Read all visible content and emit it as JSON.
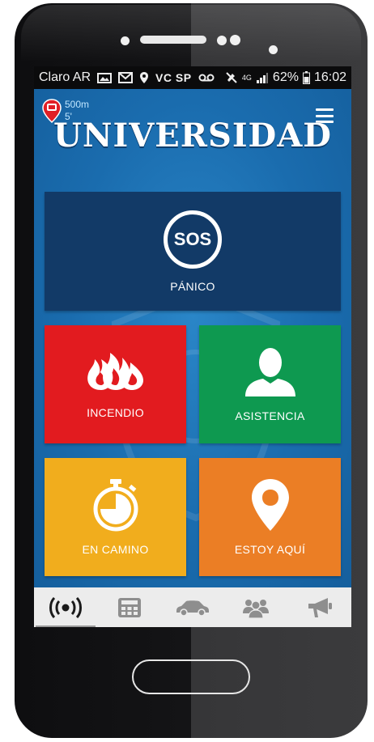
{
  "statusbar": {
    "carrier": "Claro AR",
    "network_tags": "VC SP",
    "signal_label": "4G",
    "battery": "62%",
    "time": "16:02"
  },
  "header": {
    "radius_distance": "500m",
    "radius_time": "5'",
    "title": "UNIVERSIDAD"
  },
  "tiles": {
    "panic": {
      "icon_text": "SOS",
      "label": "PÁNICO"
    },
    "fire": {
      "label": "INCENDIO"
    },
    "assistance": {
      "label": "ASISTENCIA"
    },
    "on_the_way": {
      "label": "EN CAMINO"
    },
    "here": {
      "label": "ESTOY AQUÍ"
    }
  },
  "bottom_nav": {
    "items": [
      {
        "icon": "broadcast-icon",
        "active": true
      },
      {
        "icon": "calculator-icon",
        "active": false
      },
      {
        "icon": "car-icon",
        "active": false
      },
      {
        "icon": "group-icon",
        "active": false
      },
      {
        "icon": "megaphone-icon",
        "active": false
      }
    ]
  },
  "colors": {
    "panic": "#123a67",
    "fire": "#e21b1f",
    "assistance": "#0e9950",
    "on_the_way": "#f1ad1d",
    "here": "#eb7e25",
    "background": "#1b6fb0"
  }
}
